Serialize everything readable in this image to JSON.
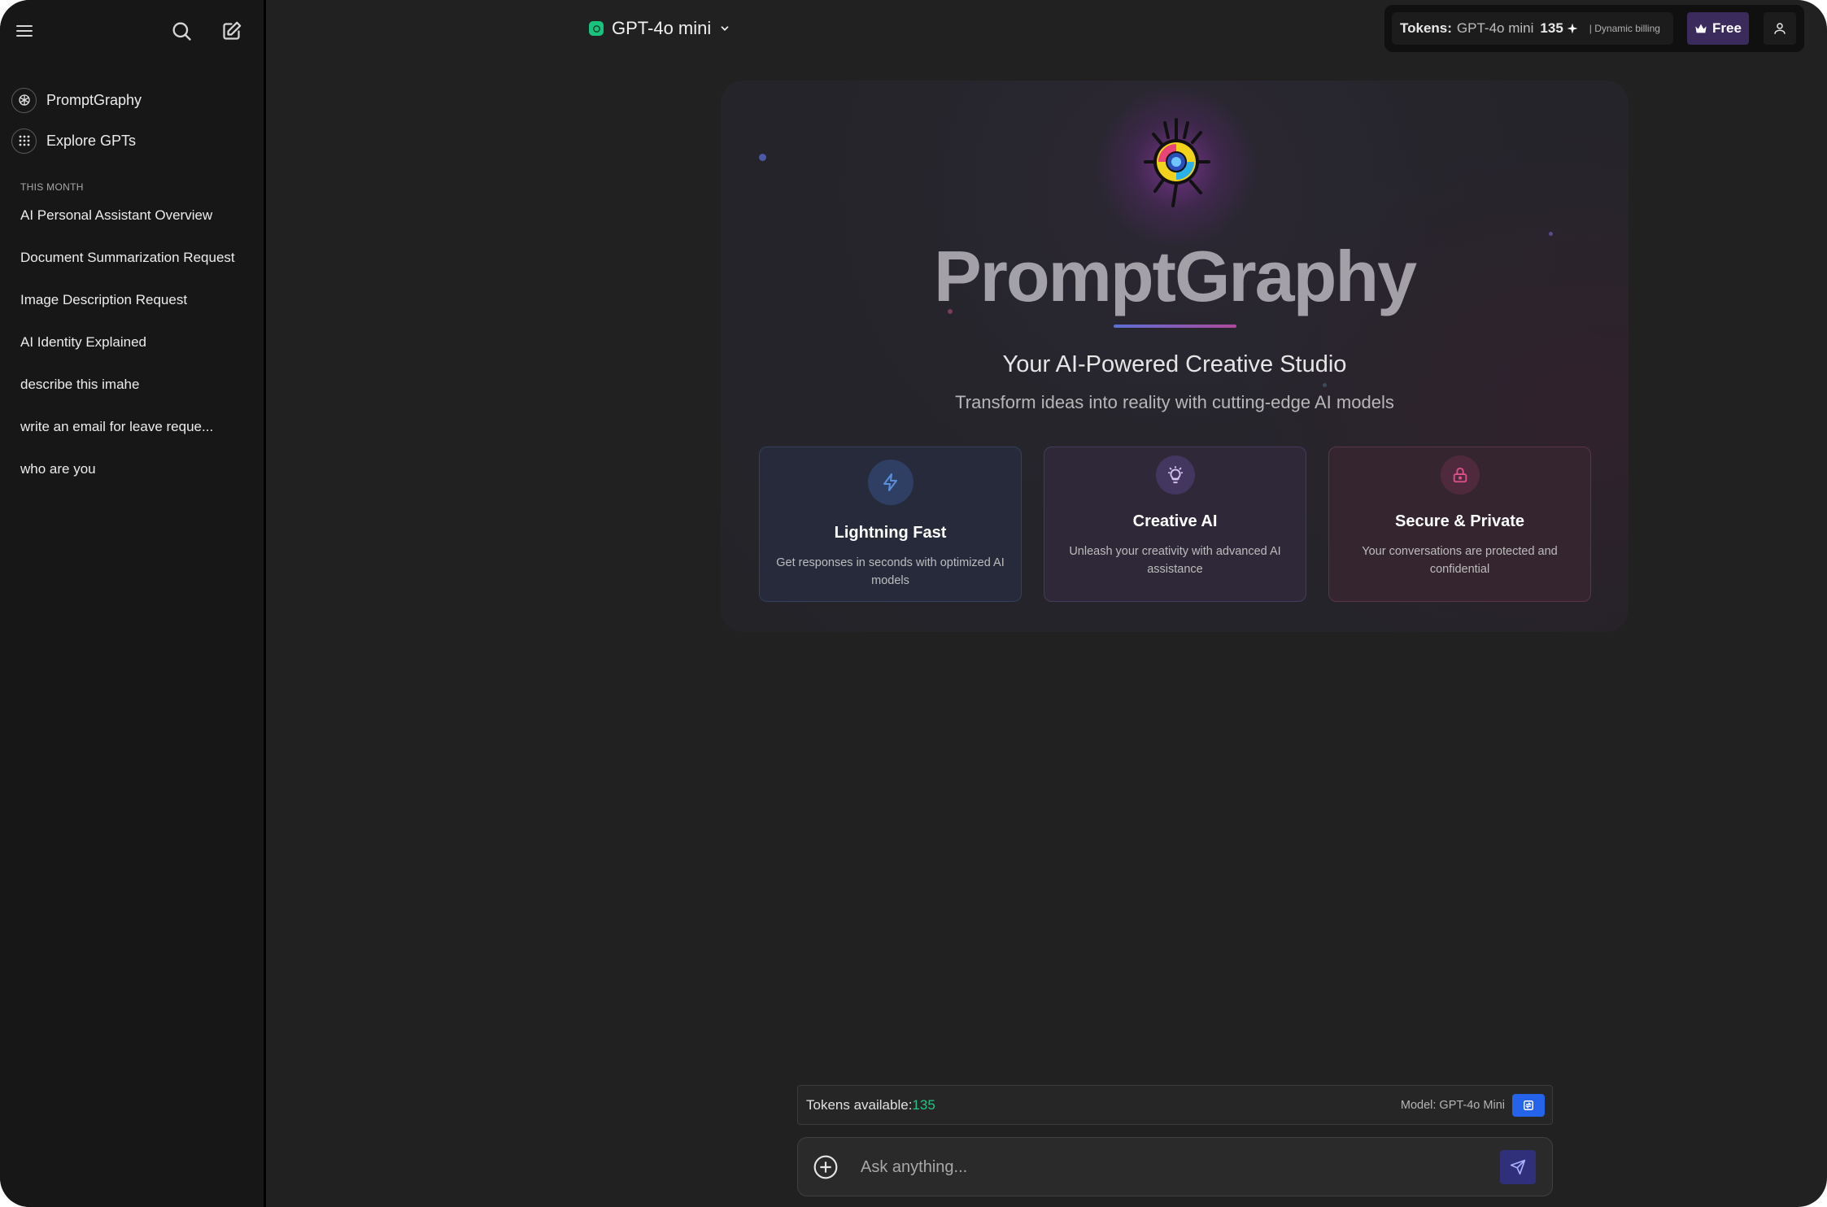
{
  "sidebar": {
    "nav": [
      {
        "label": "PromptGraphy",
        "icon": "openai-logo-icon"
      },
      {
        "label": "Explore GPTs",
        "icon": "grid-icon"
      }
    ],
    "section_label": "THIS MONTH",
    "history": [
      "AI Personal Assistant Overview",
      "Document Summarization Request",
      "Image Description Request",
      "AI Identity Explained",
      "describe this imahe",
      "write an email for leave reque...",
      "who are you"
    ]
  },
  "header": {
    "model_name": "GPT-4o mini",
    "tokens_label": "Tokens:",
    "tokens_model": "GPT-4o mini",
    "tokens_count": "135",
    "billing": "| Dynamic billing",
    "plan": "Free"
  },
  "hero": {
    "title": "PromptGraphy",
    "subtitle": "Your AI-Powered Creative Studio",
    "description": "Transform ideas into reality with cutting-edge AI models",
    "features": [
      {
        "title": "Lightning Fast",
        "desc": "Get responses in seconds with optimized AI models",
        "icon": "lightning-icon",
        "accent": "#5b8fd9"
      },
      {
        "title": "Creative AI",
        "desc": "Unleash your creativity with advanced AI assistance",
        "icon": "lightbulb-icon",
        "accent": "#c9a8f0"
      },
      {
        "title": "Secure & Private",
        "desc": "Your conversations are protected and confidential",
        "icon": "lock-icon",
        "accent": "#e0508a"
      }
    ]
  },
  "composer": {
    "tokens_available_label": "Tokens available:",
    "tokens_available_value": "135",
    "model_label": "Model: GPT-4o Mini",
    "placeholder": "Ask anything..."
  }
}
